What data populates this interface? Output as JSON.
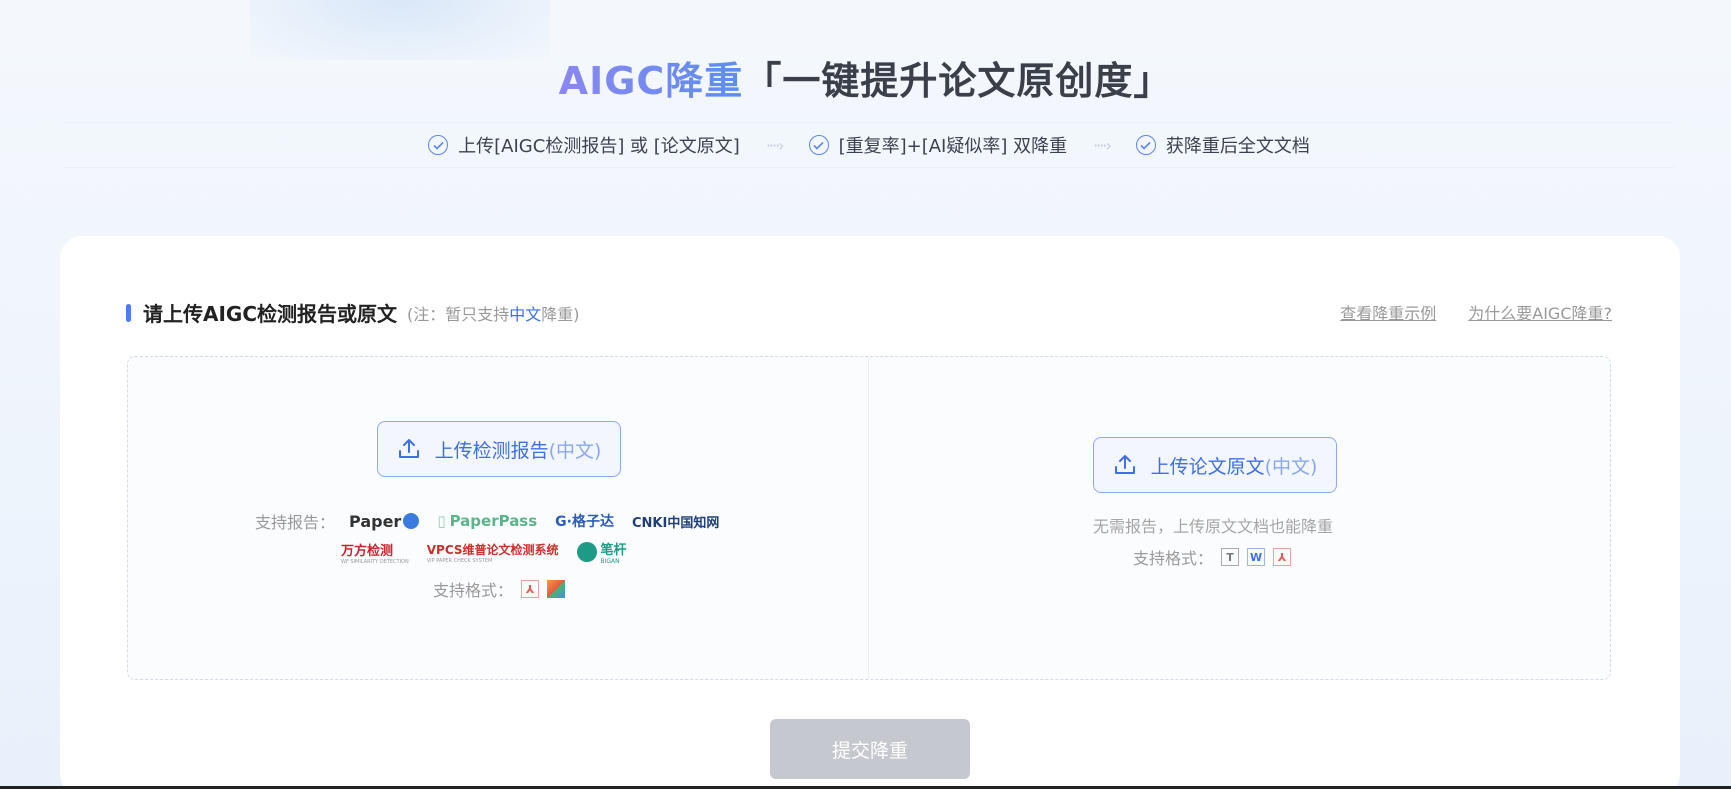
{
  "hero": {
    "accent": "AIGC降重",
    "rest": "「一键提升论文原创度」"
  },
  "steps": [
    {
      "label": "上传[AIGC检测报告] 或 [论文原文]"
    },
    {
      "label": "[重复率]+[AI疑似率] 双降重"
    },
    {
      "label": "获降重后全文文档"
    }
  ],
  "arrow": "····›",
  "section": {
    "title": "请上传AIGC检测报告或原文",
    "note_prefix": "(注：暂只支持",
    "note_highlight": "中文",
    "note_suffix": "降重)"
  },
  "links": {
    "example": "查看降重示例",
    "why": "为什么要AIGC降重?"
  },
  "left": {
    "button_main": "上传检测报告",
    "button_sub": "(中文)",
    "support_label": "支持报告：",
    "logos_row1": [
      "Paper",
      "PaperPass",
      "G·格子达",
      "CNKI中国知网"
    ],
    "logos_row2": [
      "万方检测",
      "VPCS维普论文检测系统",
      "笔杆"
    ],
    "logo_sub_vpcs": "VIP PAPER CHECK SYSTEM",
    "logo_sub_bigan": "BIGAN",
    "logo_sub_wanfang": "WF SIMILARITY DETECTION",
    "formats_label": "支持格式："
  },
  "right": {
    "button_main": "上传论文原文",
    "button_sub": "(中文)",
    "desc": "无需报告，上传原文文档也能降重",
    "formats_label": "支持格式：",
    "fmt_txt": "T",
    "fmt_word": "W"
  },
  "submit_label": "提交降重",
  "colors": {
    "accent": "#4d7cf0",
    "button_border": "#8aaaf0",
    "submit_bg": "#c5c8ce"
  }
}
